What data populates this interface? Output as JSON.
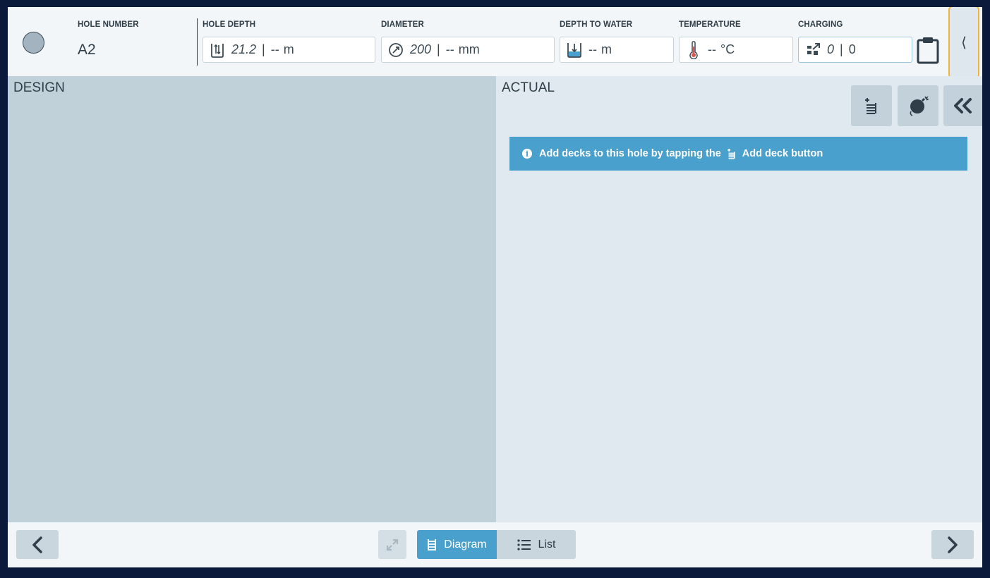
{
  "header": {
    "hole_number_label": "HOLE NUMBER",
    "hole_number_value": "A2",
    "hole_depth": {
      "label": "HOLE DEPTH",
      "planned": "21.2",
      "actual": "--",
      "unit": "m"
    },
    "diameter": {
      "label": "DIAMETER",
      "planned": "200",
      "actual": "--",
      "unit": "mm"
    },
    "depth_to_water": {
      "label": "DEPTH TO WATER",
      "value": "--",
      "unit": "m"
    },
    "temperature": {
      "label": "TEMPERATURE",
      "value": "--",
      "unit": "°C"
    },
    "charging": {
      "label": "CHARGING",
      "planned": "0",
      "actual": "0"
    },
    "collapse_glyph": "⟨"
  },
  "panels": {
    "design_title": "DESIGN",
    "actual_title": "ACTUAL",
    "info_message_before": "Add decks to this hole by tapping the",
    "info_message_after": "Add deck button"
  },
  "footer": {
    "diagram_label": "Diagram",
    "list_label": "List",
    "active_view": "Diagram"
  },
  "colors": {
    "accent": "#4aa0cc",
    "design_bg": "#c1d1d9",
    "actual_bg": "#e1e9f0",
    "highlight": "#f0b43c",
    "thermometer": "#d9534f"
  }
}
